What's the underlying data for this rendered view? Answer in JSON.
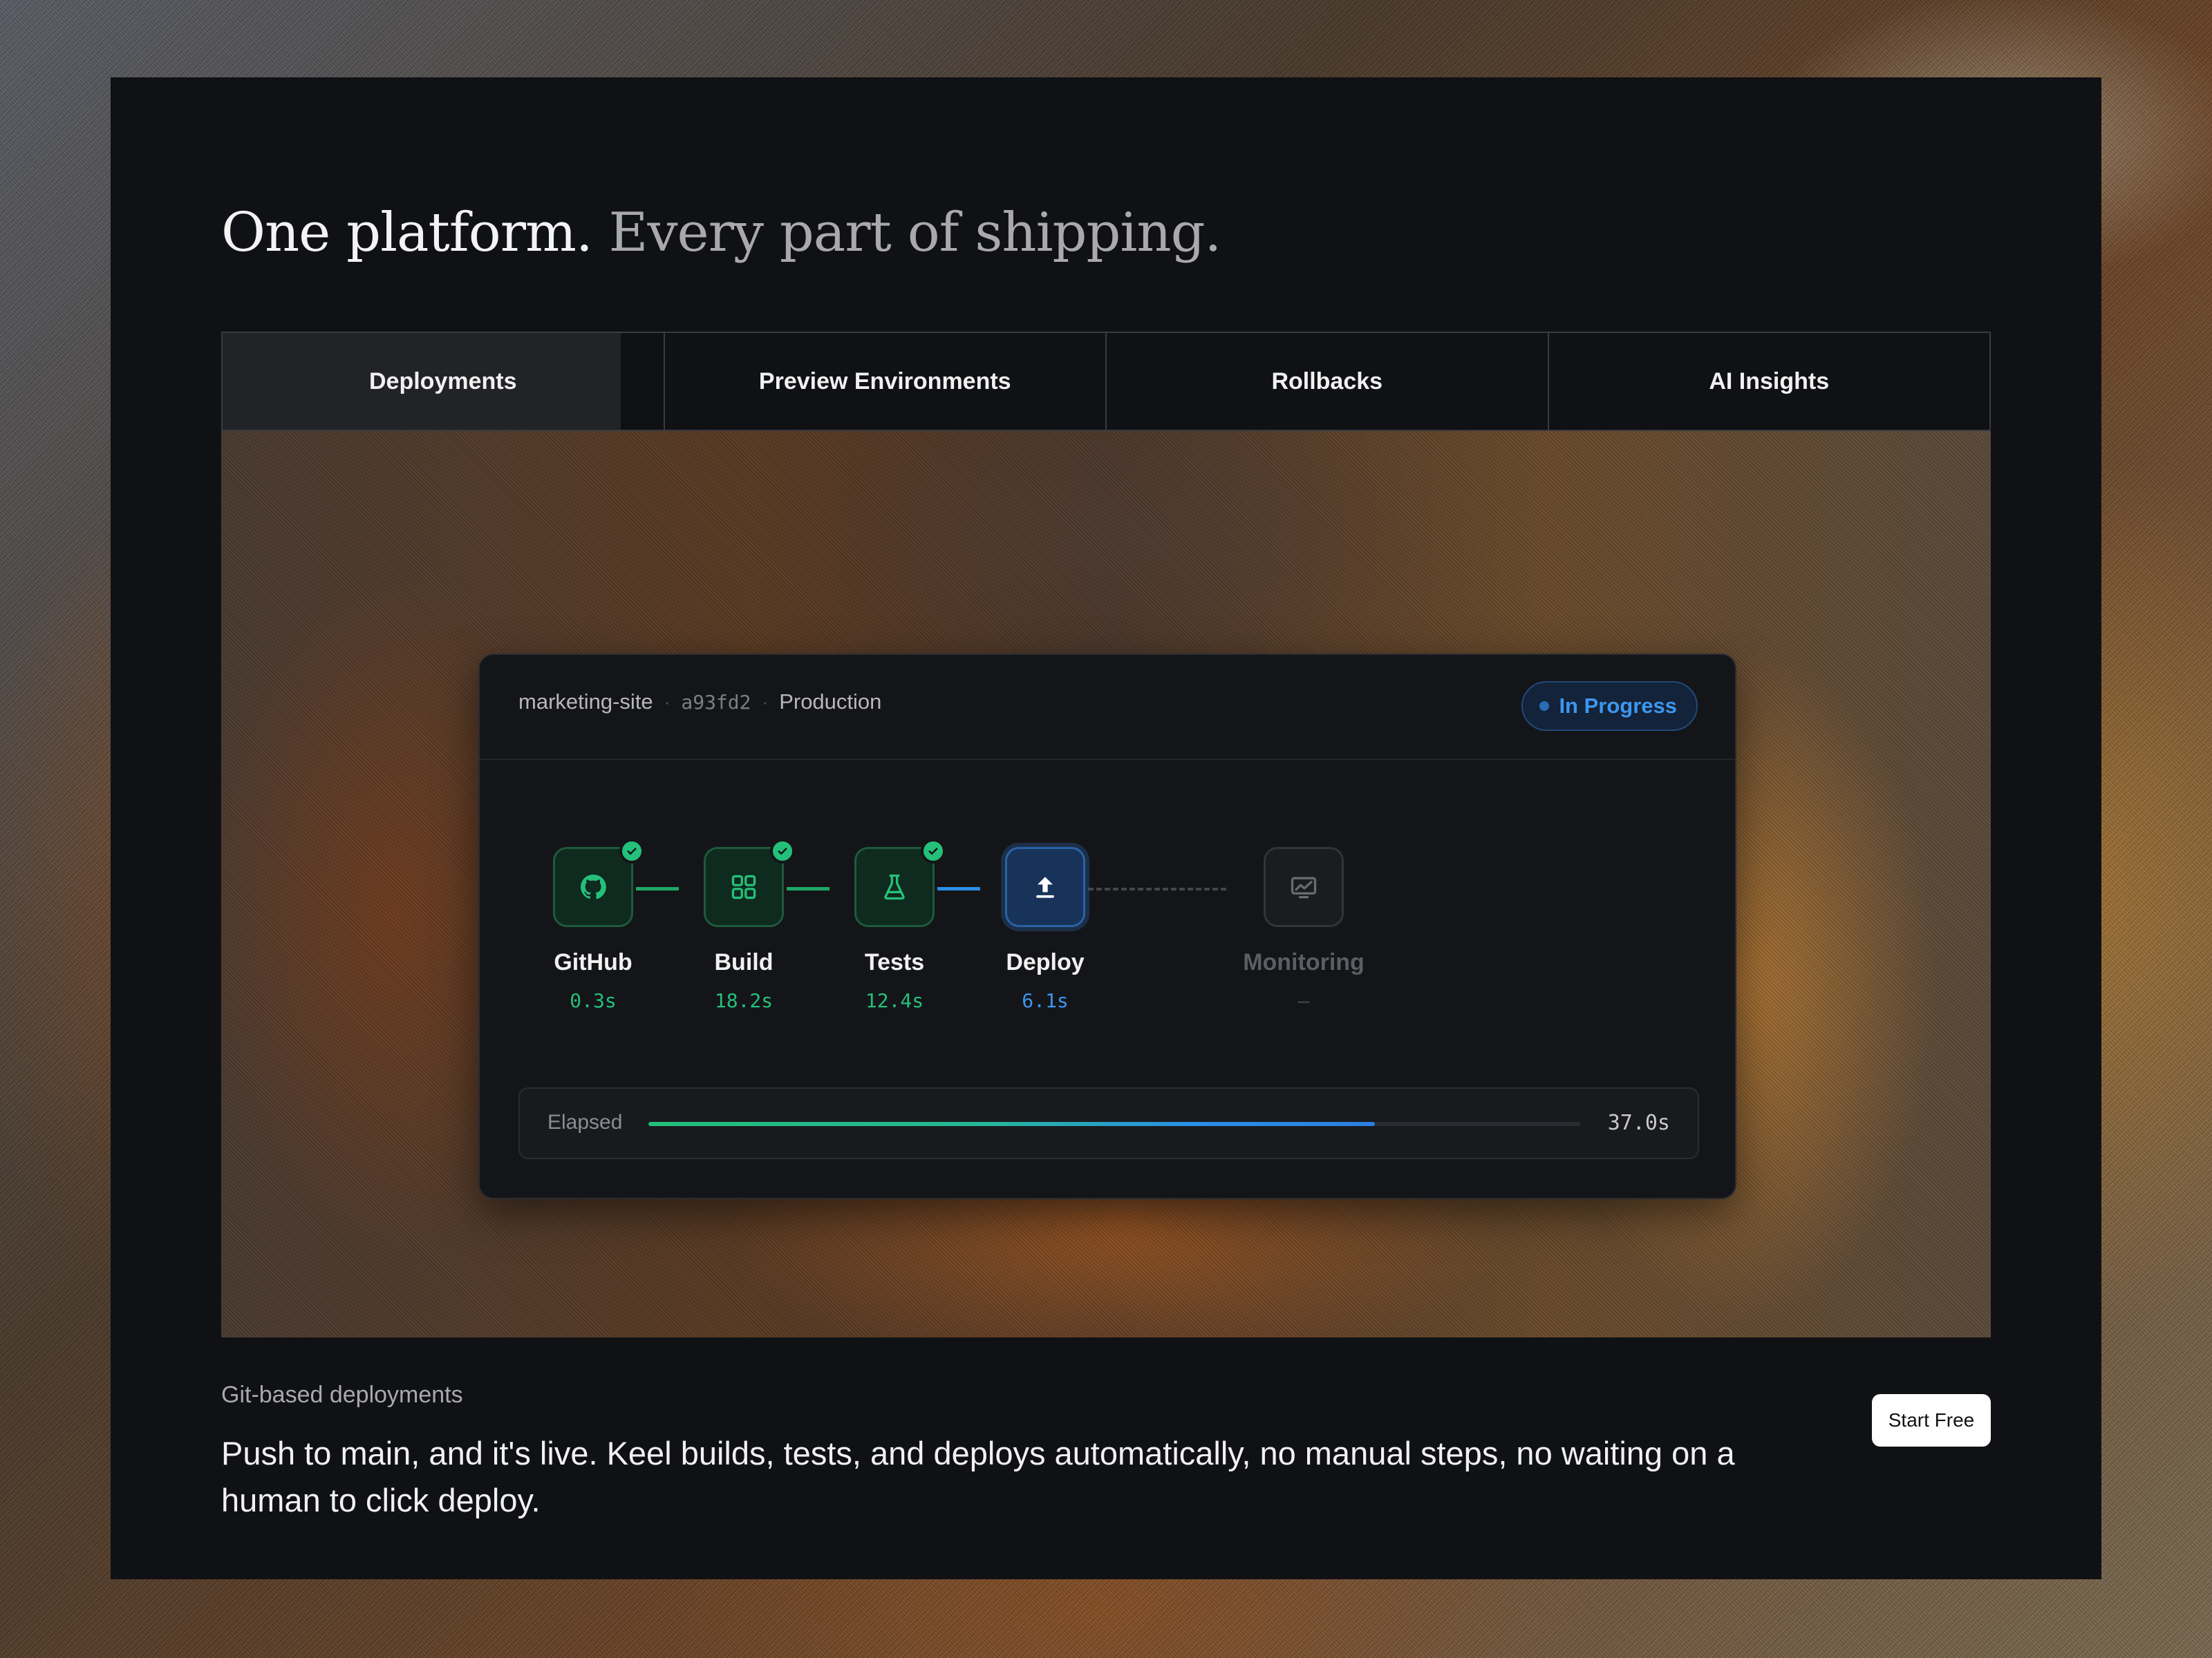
{
  "headline": {
    "strong": "One platform.",
    "muted": "Every part of shipping."
  },
  "tabs": [
    {
      "label": "Deployments",
      "active": true
    },
    {
      "label": "Preview Environments",
      "active": false
    },
    {
      "label": "Rollbacks",
      "active": false
    },
    {
      "label": "AI Insights",
      "active": false
    }
  ],
  "deploy_card": {
    "project": "marketing-site",
    "commit": "a93fd2",
    "environment": "Production",
    "separator": "·",
    "status": "In Progress",
    "steps": [
      {
        "name": "GitHub",
        "time": "0.3s",
        "state": "done",
        "icon": "github-icon"
      },
      {
        "name": "Build",
        "time": "18.2s",
        "state": "done",
        "icon": "grid-icon"
      },
      {
        "name": "Tests",
        "time": "12.4s",
        "state": "done",
        "icon": "flask-icon"
      },
      {
        "name": "Deploy",
        "time": "6.1s",
        "state": "active",
        "icon": "upload-icon"
      },
      {
        "name": "Monitoring",
        "time": "–",
        "state": "pending",
        "icon": "monitor-chart-icon"
      }
    ],
    "elapsed": {
      "label": "Elapsed",
      "value": "37.0s",
      "progress": 0.78
    }
  },
  "feature": {
    "eyebrow": "Git-based deployments",
    "description": "Push to main, and it's live. Keel builds, tests, and deploys automatically, no manual steps, no waiting on a human to click deploy.",
    "cta": "Start Free"
  },
  "colors": {
    "success": "#24c07a",
    "active": "#3d96ee",
    "background": "#101114"
  }
}
